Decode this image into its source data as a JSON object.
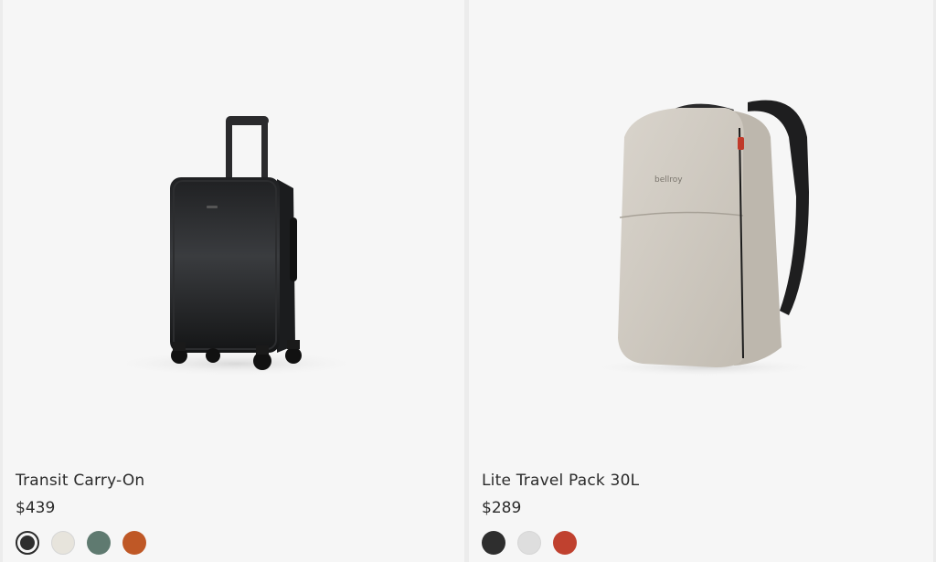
{
  "products": [
    {
      "name": "Transit Carry-On",
      "price": "$439",
      "image_label": "black hard-shell carry-on suitcase",
      "swatches": [
        {
          "name": "black",
          "color": "#2e2e2e",
          "selected": true
        },
        {
          "name": "cream",
          "color": "#e7e4dc",
          "selected": false
        },
        {
          "name": "sage green",
          "color": "#5f7a70",
          "selected": false
        },
        {
          "name": "burnt orange",
          "color": "#bf5826",
          "selected": false
        }
      ]
    },
    {
      "name": "Lite Travel Pack 30L",
      "price": "$289",
      "image_label": "light grey travel backpack",
      "logo_text": "bellroy",
      "swatches": [
        {
          "name": "black",
          "color": "#2e2e2e",
          "selected": false
        },
        {
          "name": "light grey",
          "color": "#dedede",
          "selected": false
        },
        {
          "name": "red",
          "color": "#c0412f",
          "selected": false
        }
      ]
    }
  ]
}
